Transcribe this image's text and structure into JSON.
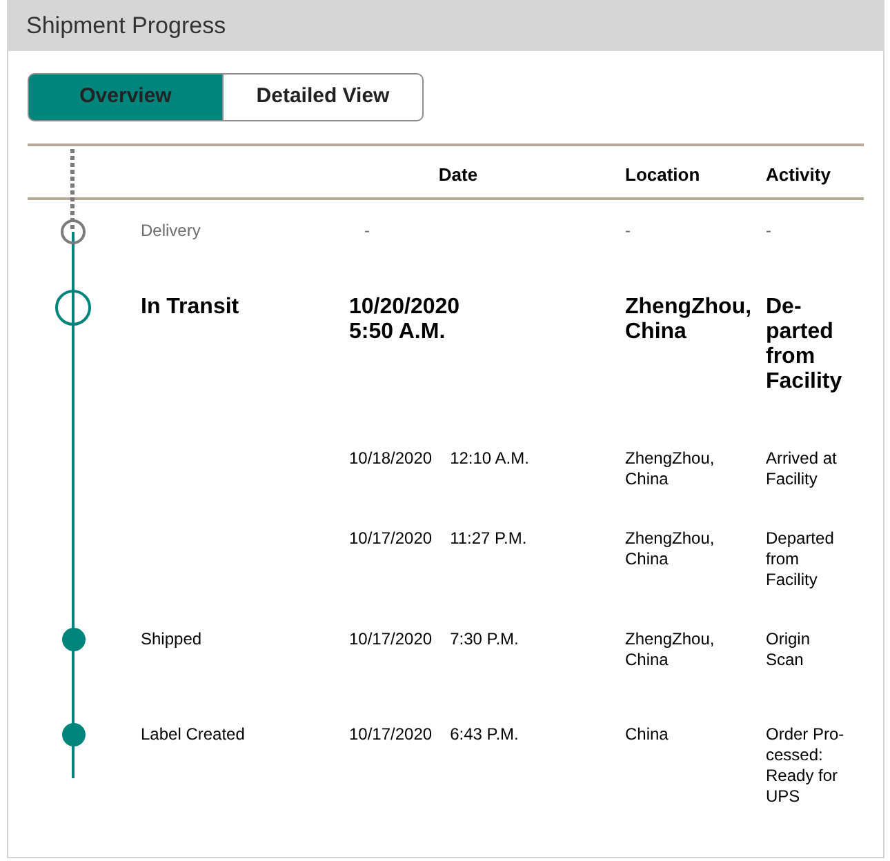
{
  "panel": {
    "title": "Shipment Progress"
  },
  "view_tabs": [
    {
      "label": "Overview",
      "selected": true
    },
    {
      "label": "Detailed View",
      "selected": false
    }
  ],
  "table": {
    "columns": [
      "Date",
      "Location",
      "Activity"
    ],
    "rows": [
      {
        "kind": "pending",
        "status": "Delivery",
        "date": "-",
        "location": "-",
        "activity": "-"
      },
      {
        "kind": "current",
        "status": "In Transit",
        "date": "10/20/2020 5:50 A.M.",
        "location": "ZhengZhou, China",
        "activity": "De-parted from Facility"
      },
      {
        "kind": "detail",
        "date": "10/18/2020",
        "time": "12:10 A.M.",
        "location": "ZhengZhou, China",
        "activity": "Arrived at Facility"
      },
      {
        "kind": "detail",
        "date": "10/17/2020",
        "time": "11:27 P.M.",
        "location": "ZhengZhou, China",
        "activity": "Departed from Facility"
      },
      {
        "kind": "done",
        "status": "Shipped",
        "date": "10/17/2020",
        "time": "7:30 P.M.",
        "location": "ZhengZhou, China",
        "activity": "Origin Scan"
      },
      {
        "kind": "done",
        "status": "Label Created",
        "date": "10/17/2020",
        "time": "6:43 P.M.",
        "location": "China",
        "activity": "Order Pro-cessed: Ready for UPS"
      }
    ]
  }
}
